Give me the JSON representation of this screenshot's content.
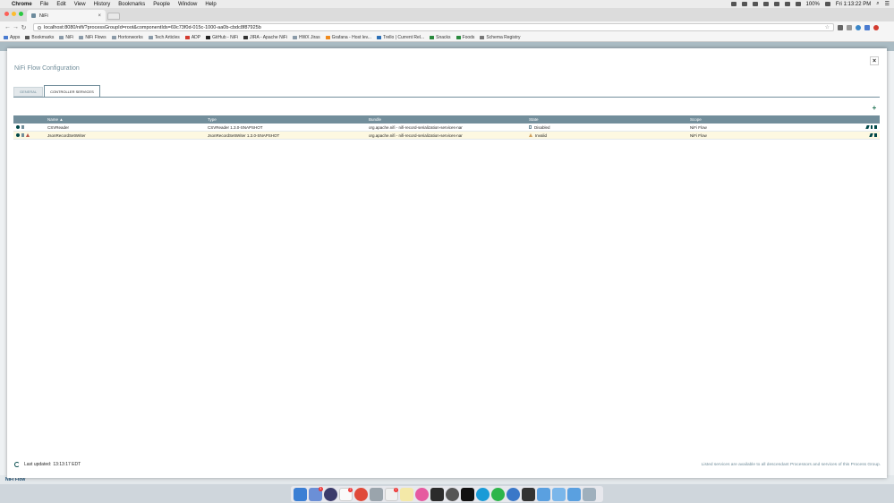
{
  "menubar": {
    "app": "Chrome",
    "items": [
      "File",
      "Edit",
      "View",
      "History",
      "Bookmarks",
      "People",
      "Window",
      "Help"
    ],
    "battery": "100%",
    "clock": "Fri 1:13:22 PM"
  },
  "browser": {
    "tab_title": "NiFi",
    "url": "localhost:8080/nifi/?processGroupId=root&componentIds=69c73f0d-015c-1000-aa0b-cbdc8f87925b"
  },
  "bookmarks": [
    {
      "label": "Apps",
      "color": "#4a7bd0"
    },
    {
      "label": "Bookmarks",
      "color": "#555555"
    },
    {
      "label": "NiFi",
      "color": "#8a9aa8"
    },
    {
      "label": "NiFi Flows",
      "color": "#8a9aa8"
    },
    {
      "label": "Hortonworks",
      "color": "#8a9aa8"
    },
    {
      "label": "Tech Articles",
      "color": "#8a9aa8"
    },
    {
      "label": "ADP",
      "color": "#d33b2f"
    },
    {
      "label": "GitHub - NiFi",
      "color": "#222222"
    },
    {
      "label": "JIRA - Apache NiFi",
      "color": "#333333"
    },
    {
      "label": "HWX Jiras",
      "color": "#8a9aa8"
    },
    {
      "label": "Grafana - Host lev...",
      "color": "#f08a1c"
    },
    {
      "label": "Trello | Current Rel...",
      "color": "#2b6fb6"
    },
    {
      "label": "Snacks",
      "color": "#2a8a3e"
    },
    {
      "label": "Foods",
      "color": "#2a8a3e"
    },
    {
      "label": "Schema Registry",
      "color": "#777777"
    }
  ],
  "dialog": {
    "title": "NiFi Flow Configuration",
    "close_symbol": "×",
    "tabs": [
      {
        "label": "GENERAL",
        "active": false
      },
      {
        "label": "CONTROLLER SERVICES",
        "active": true
      }
    ],
    "add_symbol": "+",
    "columns": {
      "name": "Name ▲",
      "type": "Type",
      "bundle": "Bundle",
      "state": "State",
      "scope": "Scope"
    },
    "rows": [
      {
        "name": "CSVReader",
        "type": "CSVReader 1.3.0-SNAPSHOT",
        "bundle": "org.apache.nifi - nifi-record-serialization-services-nar",
        "state": "Disabled",
        "scope": "NiFi Flow"
      },
      {
        "name": "JsonRecordSetWriter",
        "type": "JsonRecordSetWriter 1.3.0-SNAPSHOT",
        "bundle": "org.apache.nifi - nifi-record-serialization-services-nar",
        "state": "Invalid",
        "scope": "NiFi Flow"
      }
    ],
    "footer": {
      "last_updated_label": "Last updated:",
      "last_updated_value": "13:13:17 EDT",
      "note": "Listed services are available to all descendant Processors and services of this Process Group."
    }
  },
  "canvas": {
    "breadcrumb": "NiFi Flow"
  },
  "dock": {
    "badges": {
      "mail": "4",
      "calendar": "2",
      "notes": "1"
    }
  },
  "colors": {
    "nifi_header": "#728e9b",
    "nifi_text": "#262626",
    "invalid": "#ba554a",
    "row_highlight": "#fdf8e1"
  }
}
